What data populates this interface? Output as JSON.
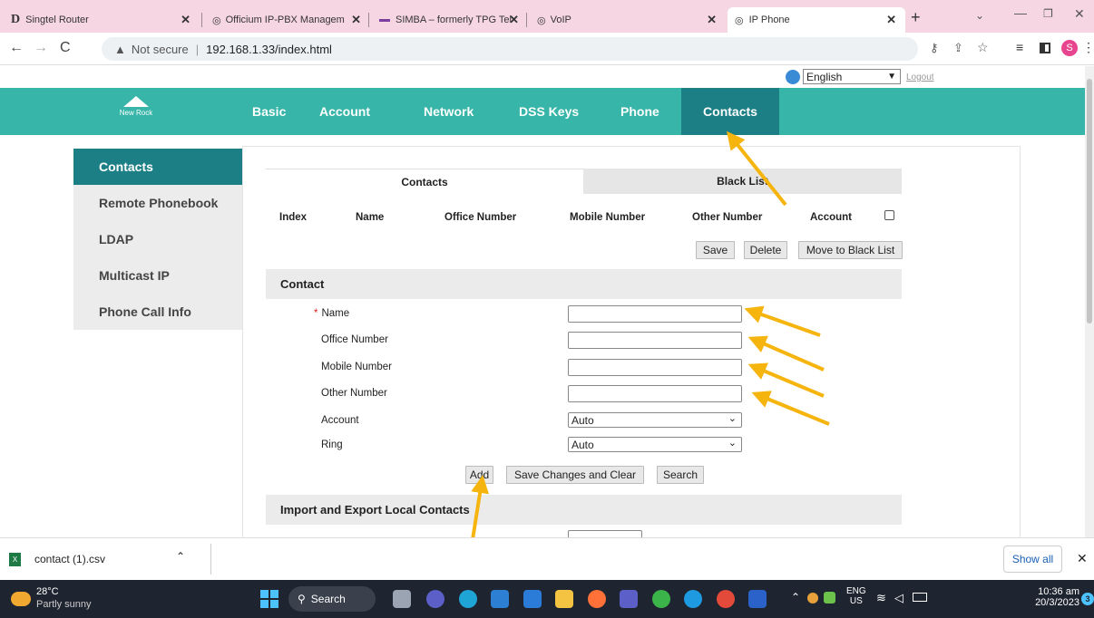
{
  "browser": {
    "tabs": [
      {
        "title": "Singtel Router"
      },
      {
        "title": "Officium IP-PBX Managem"
      },
      {
        "title": "SIMBA – formerly TPG Tel"
      },
      {
        "title": "VoIP"
      },
      {
        "title": "IP Phone"
      }
    ],
    "security_label": "Not secure",
    "url": "192.168.1.33/index.html",
    "profile_initial": "S"
  },
  "page": {
    "language": "English",
    "logout": "Logout",
    "logo_text": "New Rock",
    "nav": [
      "Basic",
      "Account",
      "Network",
      "DSS Keys",
      "Phone",
      "Contacts"
    ],
    "sidebar": [
      "Contacts",
      "Remote Phonebook",
      "LDAP",
      "Multicast IP",
      "Phone Call Info"
    ],
    "subtabs": [
      "Contacts",
      "Black List"
    ],
    "table_headers": [
      "Index",
      "Name",
      "Office Number",
      "Mobile Number",
      "Other Number",
      "Account"
    ],
    "list_buttons": [
      "Save",
      "Delete",
      "Move to Black List"
    ],
    "contact_section": "Contact",
    "fields": {
      "required_mark": "*",
      "name": "Name",
      "office": "Office Number",
      "mobile": "Mobile Number",
      "other": "Other Number",
      "account": "Account",
      "account_value": "Auto",
      "ring": "Ring",
      "ring_value": "Auto"
    },
    "form_buttons": [
      "Add",
      "Save Changes and Clear",
      "Search"
    ],
    "import_section": "Import and Export Local Contacts"
  },
  "downloads": {
    "file": "contact (1).csv",
    "show_all": "Show all"
  },
  "taskbar": {
    "temperature": "28°C",
    "weather": "Partly sunny",
    "search": "Search",
    "lang1": "ENG",
    "lang2": "US",
    "time": "10:36 am",
    "date": "20/3/2023",
    "notif_count": "3"
  },
  "colors": {
    "nav_bg": "#36b5a8",
    "nav_active": "#1d7f86",
    "annotation_arrow": "#f6b40e"
  }
}
